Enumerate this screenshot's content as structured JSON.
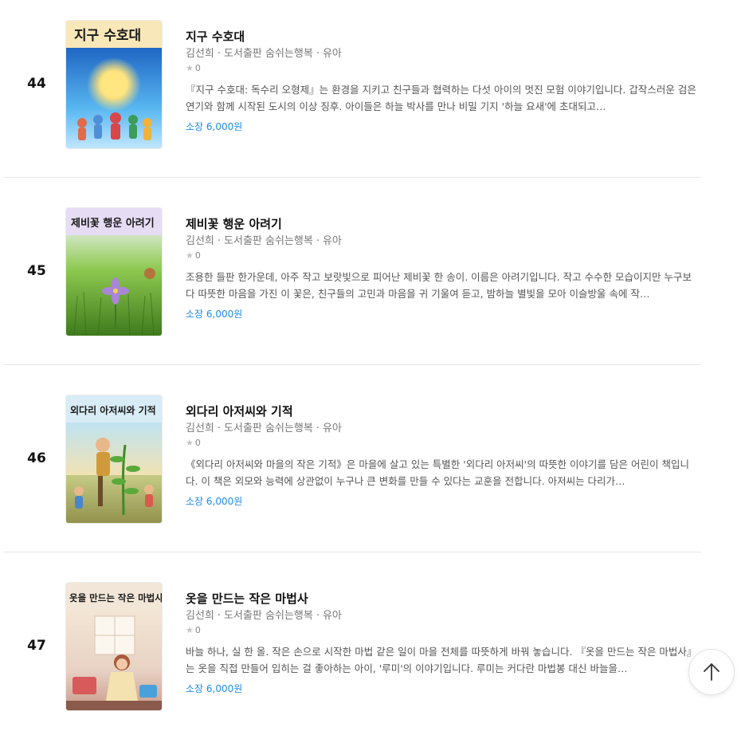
{
  "books": [
    {
      "rank": "44",
      "title": "지구 수호대",
      "cover_title": "지구 수호대",
      "author": "김선희",
      "publisher": "도서출판 숨쉬는행복",
      "category": "유아",
      "rating_count": "0",
      "description": "『지구 수호대: 독수리 오형제』는 환경을 지키고 친구들과 협력하는 다섯 아이의 멋진 모험 이야기입니다. 갑작스러운 검은 연기와 함께 시작된 도시의 이상 징후. 아이들은 하늘 박사를 만나 비밀 기지 '하늘 요새'에 초대되고…",
      "price": "소장 6,000원"
    },
    {
      "rank": "45",
      "title": "제비꽃 행운 아려기",
      "cover_title": "제비꽃 행운 아려기",
      "author": "김선희",
      "publisher": "도서출판 숨쉬는행복",
      "category": "유아",
      "rating_count": "0",
      "description": "조용한 들판 한가운데, 아주 작고 보랏빛으로 피어난 제비꽃 한 송이. 이름은 아려기입니다. 작고 수수한 모습이지만 누구보다 따뜻한 마음을 가진 이 꽃은, 친구들의 고민과 마음을 귀 기울여 듣고, 밤하늘 별빛을 모아 이슬방울 속에 작…",
      "price": "소장 6,000원"
    },
    {
      "rank": "46",
      "title": "외다리 아저씨와 기적",
      "cover_title": "외다리 아저씨와 기적",
      "author": "김선희",
      "publisher": "도서출판 숨쉬는행복",
      "category": "유아",
      "rating_count": "0",
      "description": "《외다리 아저씨와 마을의 작은 기적》은 마을에 살고 있는 특별한 '외다리 아저씨'의 따뜻한 이야기를 담은 어린이 책입니다. 이 책은 외모와 능력에 상관없이 누구나 큰 변화를 만들 수 있다는 교훈을 전합니다. 아저씨는 다리가…",
      "price": "소장 6,000원"
    },
    {
      "rank": "47",
      "title": "옷을 만드는 작은 마법사",
      "cover_title": "옷을 만드는 작은 마법사",
      "author": "김선희",
      "publisher": "도서출판 숨쉬는행복",
      "category": "유아",
      "rating_count": "0",
      "description": "바늘 하나, 실 한 올. 작은 손으로 시작한 마법 같은 일이 마을 전체를 따뜻하게 바꿔 놓습니다. 『옷을 만드는 작은 마법사』는 옷을 직접 만들어 입히는 걸 좋아하는 아이, '루미'의 이야기입니다. 루미는 커다란 마법봉 대신 바늘을…",
      "price": "소장 6,000원"
    }
  ],
  "scroll_top_icon": "arrow-up-icon",
  "colors": {
    "price": "#1f8ce6",
    "star": "#c4c4c4"
  }
}
